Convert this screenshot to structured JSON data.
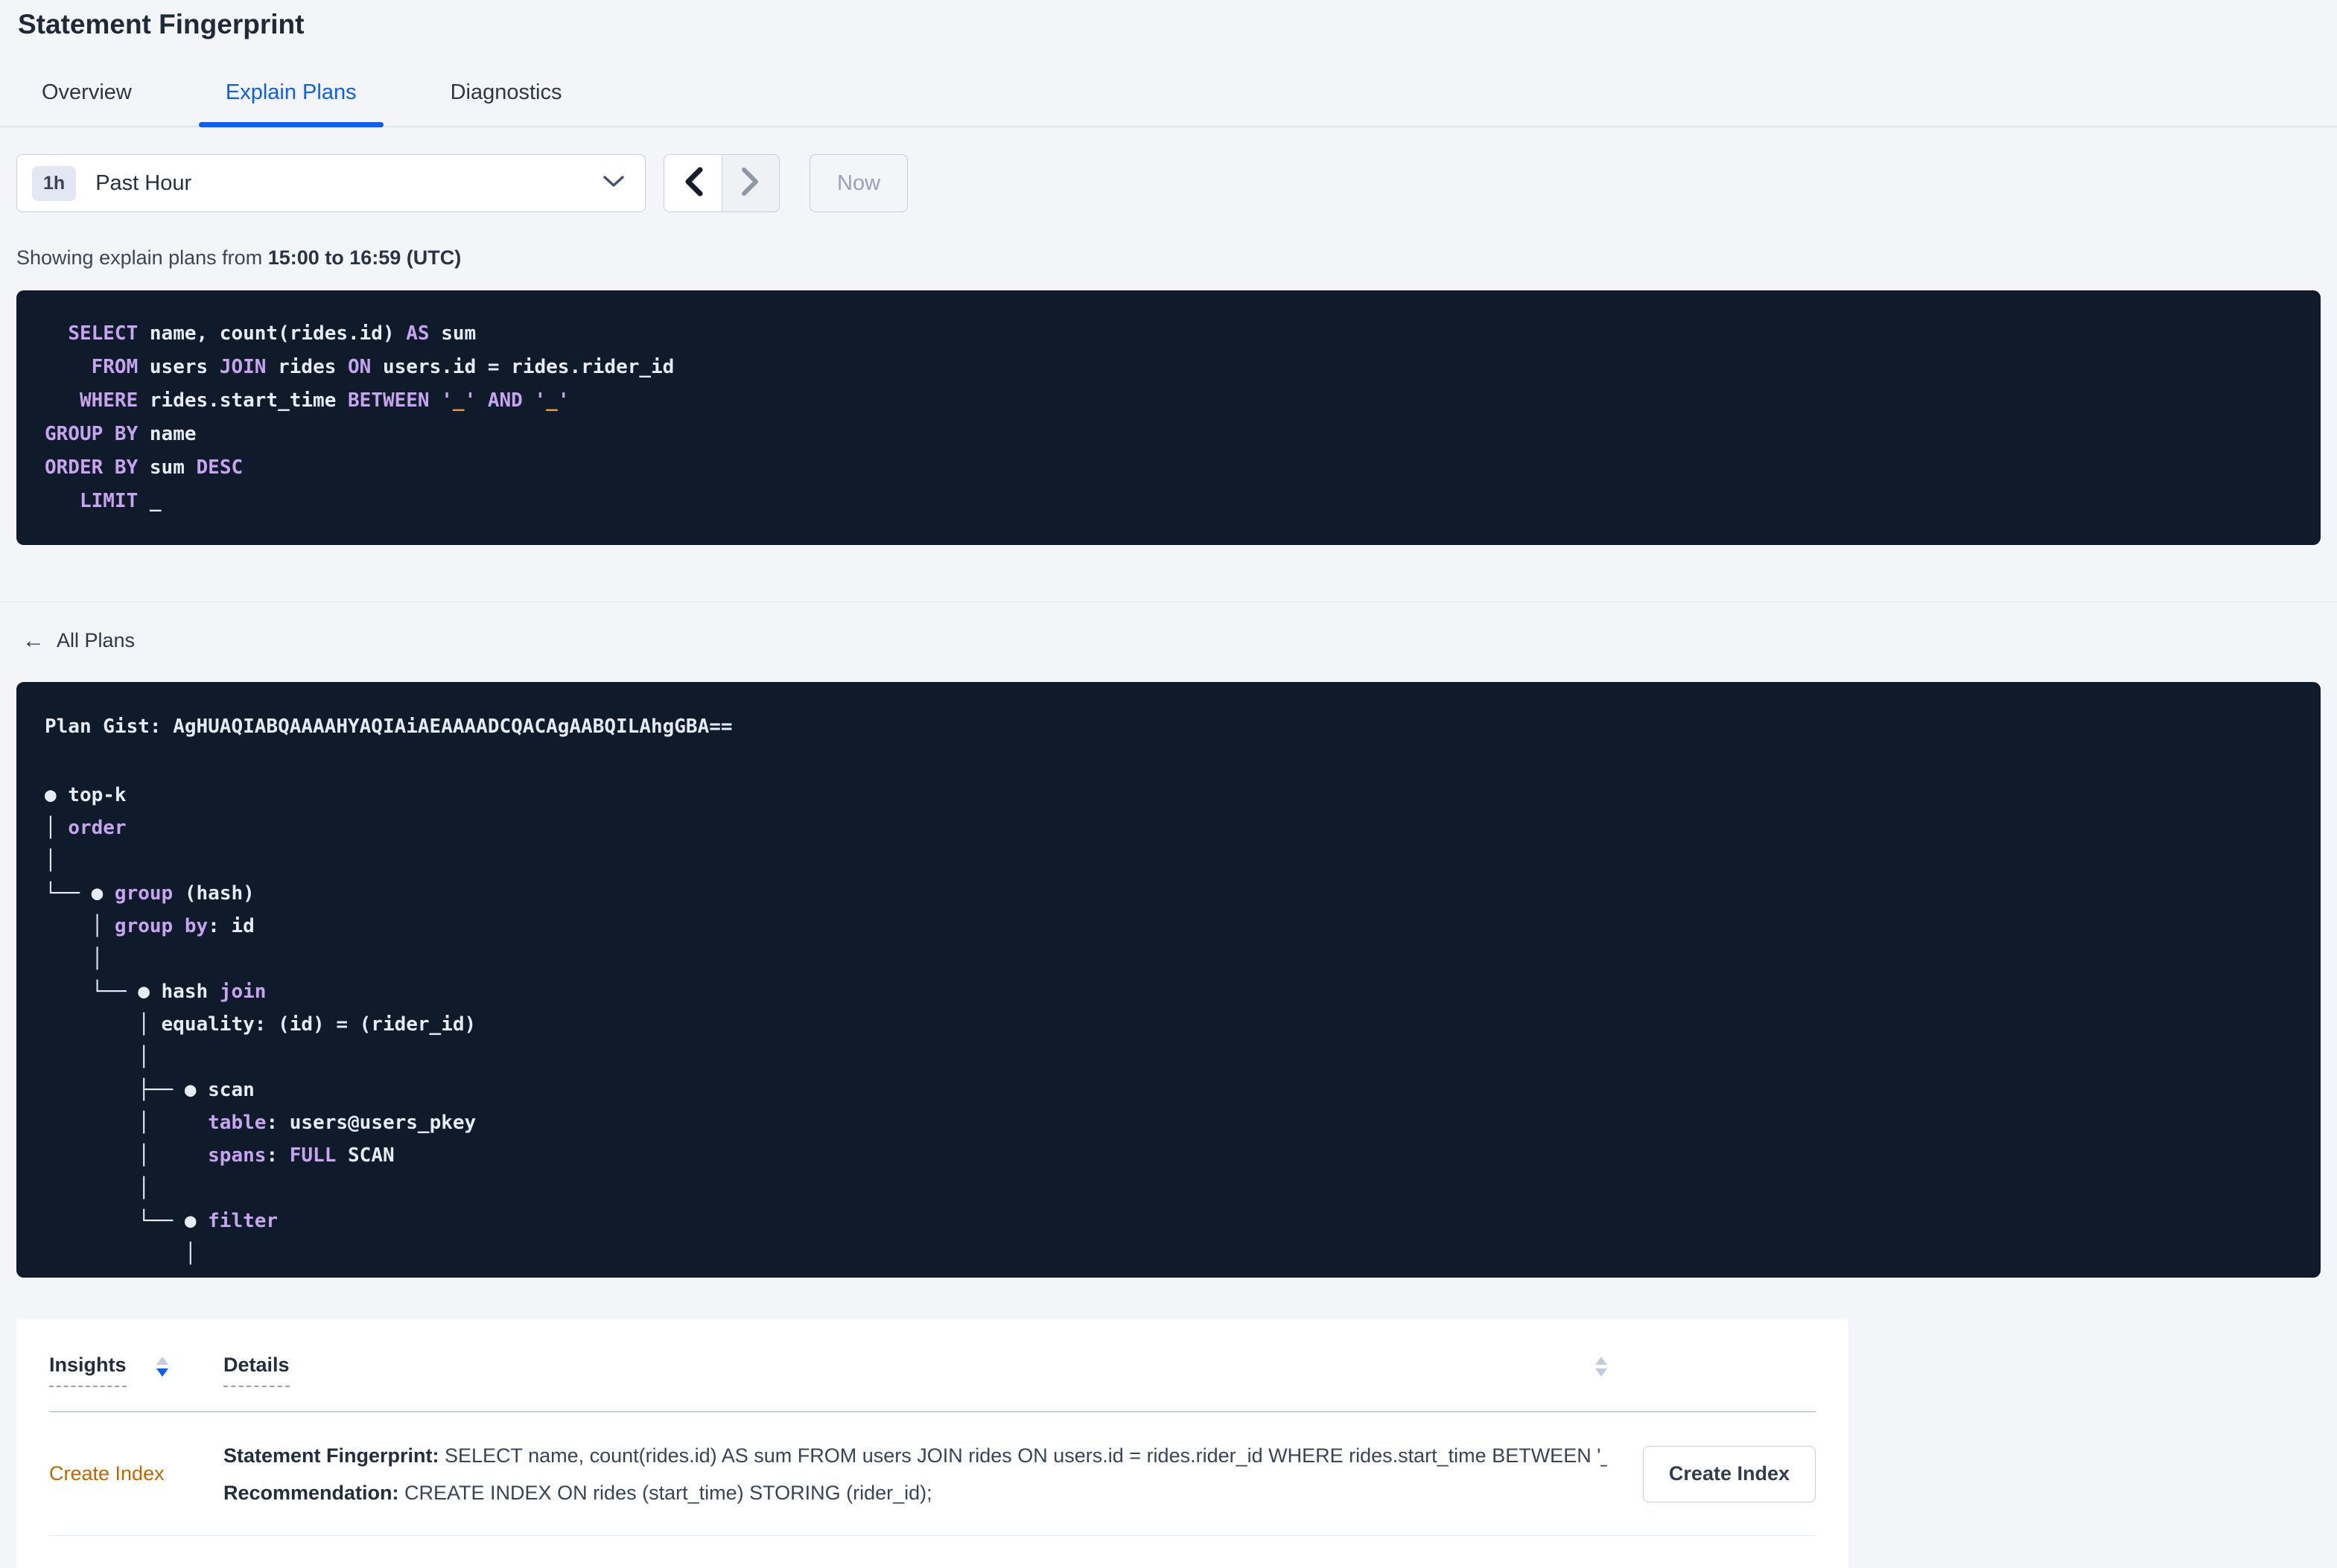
{
  "colors": {
    "accent_blue": "#0b5dff",
    "keyword_purple": "#c6a5ee",
    "literal_orange": "#e9a03c",
    "code_background": "#0f1a2b",
    "insight_link_orange": "#bc6700"
  },
  "header": {
    "title": "Statement Fingerprint"
  },
  "tabs": [
    {
      "label": "Overview"
    },
    {
      "label": "Explain Plans"
    },
    {
      "label": "Diagnostics"
    }
  ],
  "time_picker": {
    "badge": "1h",
    "selected": "Past Hour",
    "now_button": "Now"
  },
  "caption": {
    "prefix": "Showing explain plans from ",
    "range": "15:00 to 16:59 (UTC)"
  },
  "sql": {
    "lines": [
      [
        {
          "t": "  ",
          "c": "p"
        },
        {
          "t": "SELECT",
          "c": "k"
        },
        {
          "t": " name, count(rides.id) ",
          "c": "p"
        },
        {
          "t": "AS",
          "c": "k"
        },
        {
          "t": " sum",
          "c": "p"
        }
      ],
      [
        {
          "t": "    ",
          "c": "p"
        },
        {
          "t": "FROM",
          "c": "k"
        },
        {
          "t": " users ",
          "c": "p"
        },
        {
          "t": "JOIN",
          "c": "k"
        },
        {
          "t": " rides ",
          "c": "p"
        },
        {
          "t": "ON",
          "c": "k"
        },
        {
          "t": " users.id = rides.rider_id",
          "c": "p"
        }
      ],
      [
        {
          "t": "   ",
          "c": "p"
        },
        {
          "t": "WHERE",
          "c": "k"
        },
        {
          "t": " rides.start_time ",
          "c": "p"
        },
        {
          "t": "BETWEEN",
          "c": "k"
        },
        {
          "t": " ",
          "c": "p"
        },
        {
          "t": "'",
          "c": "k"
        },
        {
          "t": "_",
          "c": "o"
        },
        {
          "t": "'",
          "c": "k"
        },
        {
          "t": " ",
          "c": "p"
        },
        {
          "t": "AND",
          "c": "k"
        },
        {
          "t": " ",
          "c": "p"
        },
        {
          "t": "'",
          "c": "k"
        },
        {
          "t": "_",
          "c": "o"
        },
        {
          "t": "'",
          "c": "k"
        }
      ],
      [
        {
          "t": "GROUP BY",
          "c": "k"
        },
        {
          "t": " name",
          "c": "p"
        }
      ],
      [
        {
          "t": "ORDER BY",
          "c": "k"
        },
        {
          "t": " sum ",
          "c": "p"
        },
        {
          "t": "DESC",
          "c": "k"
        }
      ],
      [
        {
          "t": "   ",
          "c": "p"
        },
        {
          "t": "LIMIT",
          "c": "k"
        },
        {
          "t": " _",
          "c": "p"
        }
      ]
    ]
  },
  "plans_nav": {
    "back_icon": "←",
    "back_label": "All Plans"
  },
  "plan": {
    "gist_label": "Plan Gist: ",
    "gist": "AgHUAQIABQAAAAHYAQIAiAEAAAADCQACAgAABQILAhgGBA==",
    "tree": [
      [
        {
          "t": "● top-k",
          "c": "p"
        }
      ],
      [
        {
          "t": "│ ",
          "c": "p"
        },
        {
          "t": "order",
          "c": "k"
        }
      ],
      [
        {
          "t": "│",
          "c": "p"
        }
      ],
      [
        {
          "t": "└── ● ",
          "c": "p"
        },
        {
          "t": "group",
          "c": "k"
        },
        {
          "t": " (hash)",
          "c": "p"
        }
      ],
      [
        {
          "t": "    │ ",
          "c": "p"
        },
        {
          "t": "group by",
          "c": "k"
        },
        {
          "t": ": id",
          "c": "p"
        }
      ],
      [
        {
          "t": "    │",
          "c": "p"
        }
      ],
      [
        {
          "t": "    └── ● hash ",
          "c": "p"
        },
        {
          "t": "join",
          "c": "k"
        }
      ],
      [
        {
          "t": "        │ equality: (id) = (rider_id)",
          "c": "p"
        }
      ],
      [
        {
          "t": "        │",
          "c": "p"
        }
      ],
      [
        {
          "t": "        ├── ● scan",
          "c": "p"
        }
      ],
      [
        {
          "t": "        │     ",
          "c": "p"
        },
        {
          "t": "table",
          "c": "k"
        },
        {
          "t": ": users@users_pkey",
          "c": "p"
        }
      ],
      [
        {
          "t": "        │     ",
          "c": "p"
        },
        {
          "t": "spans",
          "c": "k"
        },
        {
          "t": ": ",
          "c": "p"
        },
        {
          "t": "FULL",
          "c": "k"
        },
        {
          "t": " SCAN",
          "c": "p"
        }
      ],
      [
        {
          "t": "        │",
          "c": "p"
        }
      ],
      [
        {
          "t": "        └── ● ",
          "c": "p"
        },
        {
          "t": "filter",
          "c": "k"
        }
      ],
      [
        {
          "t": "            │",
          "c": "p"
        }
      ]
    ]
  },
  "insights": {
    "columns": [
      {
        "label": "Insights"
      },
      {
        "label": "Details"
      }
    ],
    "rows": [
      {
        "insight": "Create Index",
        "fingerprint_label": "Statement Fingerprint:",
        "fingerprint": " SELECT name, count(rides.id) AS sum FROM users JOIN rides ON users.id = rides.rider_id WHERE rides.start_time BETWEEN '_…",
        "recommendation_label": "Recommendation:",
        "recommendation": " CREATE INDEX ON rides (start_time) STORING (rider_id);",
        "action": "Create Index"
      }
    ]
  }
}
